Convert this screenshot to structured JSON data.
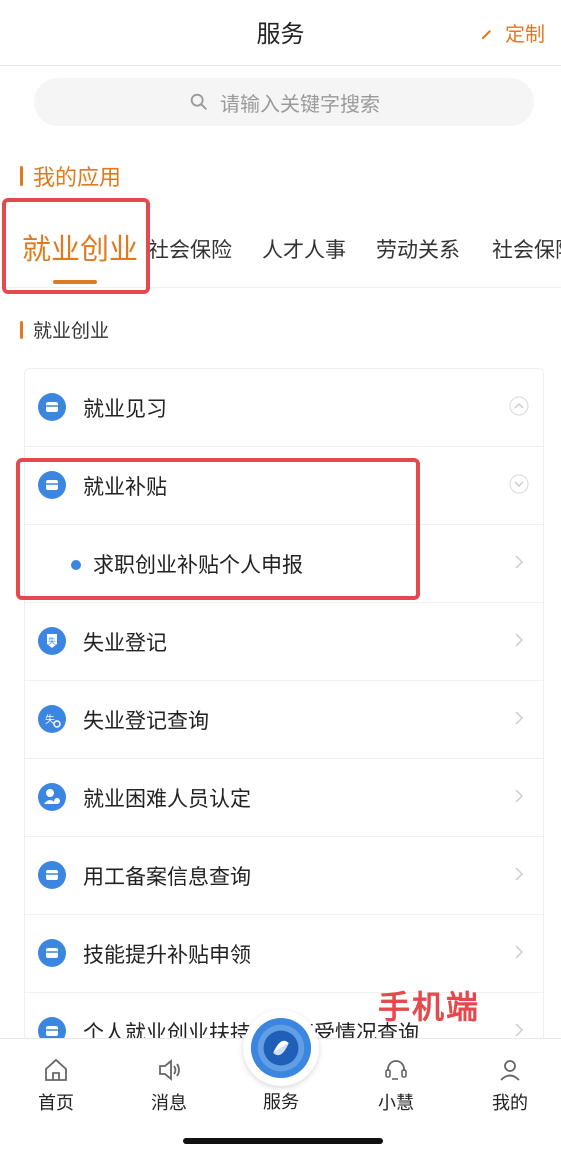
{
  "header": {
    "title": "服务",
    "customize_label": "定制"
  },
  "search": {
    "placeholder": "请输入关键字搜索"
  },
  "section": {
    "my_apps": "我的应用"
  },
  "tabs": [
    {
      "label": "就业创业",
      "active": true
    },
    {
      "label": "社会保险"
    },
    {
      "label": "人才人事"
    },
    {
      "label": "劳动关系"
    },
    {
      "label": "社会保险"
    }
  ],
  "sub_section": {
    "title": "就业创业"
  },
  "list": {
    "items": [
      {
        "label": "就业见习",
        "icon": "job-practice-icon",
        "right_icon": "collapse-chevron-icon"
      },
      {
        "label": "就业补贴",
        "icon": "job-subsidy-icon",
        "right_icon": "expand-chevron-icon"
      },
      {
        "label": "求职创业补贴个人申报",
        "child": true
      },
      {
        "label": "失业登记",
        "icon": "unemployment-register-icon"
      },
      {
        "label": "失业登记查询",
        "icon": "unemployment-query-icon"
      },
      {
        "label": "就业困难人员认定",
        "icon": "difficulty-identify-icon"
      },
      {
        "label": "用工备案信息查询",
        "icon": "employment-record-icon"
      },
      {
        "label": "技能提升补贴申领",
        "icon": "skill-subsidy-icon"
      },
      {
        "label": "个人就业创业扶持政策享受情况查询",
        "icon": "policy-query-icon"
      }
    ]
  },
  "watermark": {
    "text": "手机端"
  },
  "bottom_nav": {
    "items": [
      {
        "label": "首页",
        "icon": "home-icon"
      },
      {
        "label": "消息",
        "icon": "message-icon"
      },
      {
        "label": "服务",
        "icon": "service-logo-icon"
      },
      {
        "label": "小慧",
        "icon": "assistant-icon"
      },
      {
        "label": "我的",
        "icon": "profile-icon"
      }
    ]
  },
  "colors": {
    "accent": "#e07a1f",
    "highlight": "#e5484d",
    "icon_blue": "#3a86e0"
  }
}
